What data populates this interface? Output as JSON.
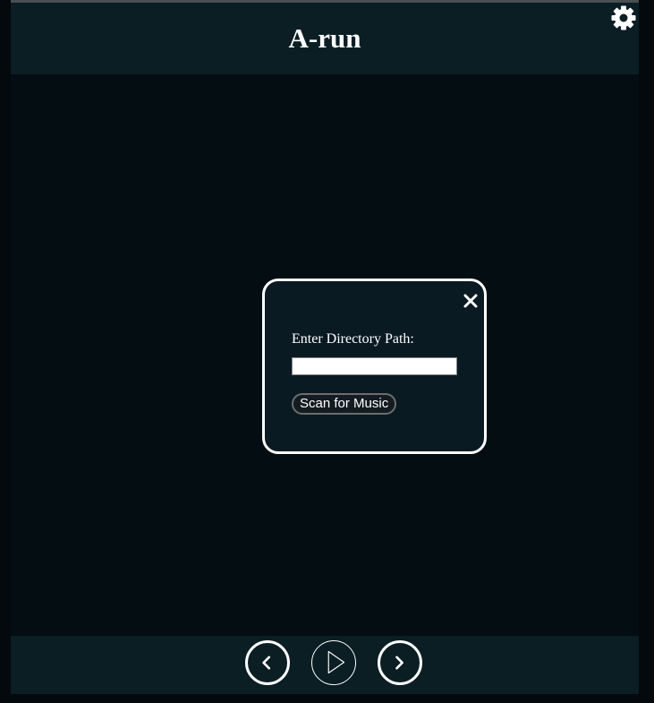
{
  "app": {
    "title": "A-run"
  },
  "header": {
    "settings_icon": "gear-icon"
  },
  "dialog": {
    "close_icon": "close-icon",
    "label": "Enter Directory Path:",
    "input_value": "",
    "input_placeholder": "",
    "scan_button_label": "Scan for Music"
  },
  "controls": {
    "previous_icon": "chevron-left-icon",
    "play_icon": "play-icon",
    "next_icon": "chevron-right-icon"
  },
  "colors": {
    "background": "#040d12",
    "header_footer": "#0a1e24",
    "dialog_background": "#0a1a23",
    "text": "#ffffff"
  }
}
